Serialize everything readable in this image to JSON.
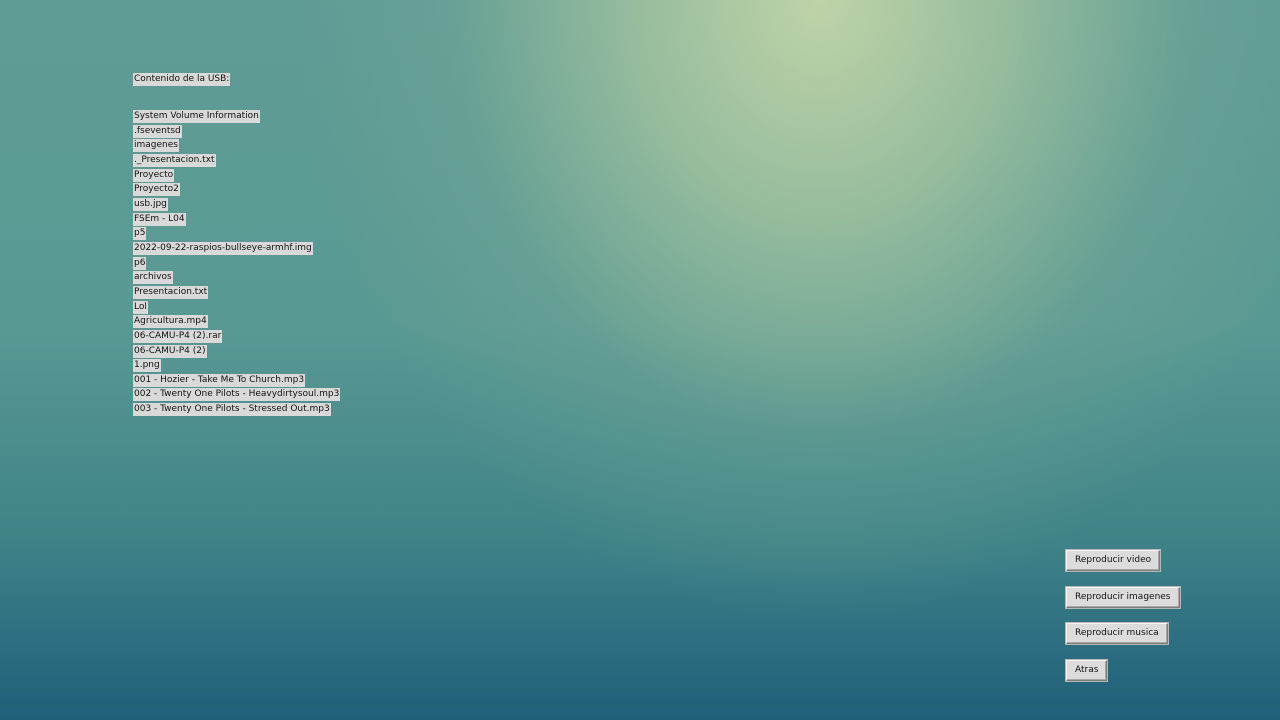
{
  "heading": "Contenido de la USB:",
  "files": [
    "System Volume Information",
    ".fseventsd",
    "imagenes",
    "._Presentacion.txt",
    "Proyecto",
    "Proyecto2",
    "usb.jpg",
    "FSEm - L04",
    "p5",
    "2022-09-22-raspios-bullseye-armhf.img",
    "p6",
    "archivos",
    "Presentacion.txt",
    "Lol",
    "Agricultura.mp4",
    "06-CAMU-P4 (2).rar",
    "06-CAMU-P4 (2)",
    "1.png",
    "001 - Hozier - Take Me To Church.mp3",
    "002 - Twenty One Pilots - Heavydirtysoul.mp3",
    "003 - Twenty One Pilots - Stressed Out.mp3"
  ],
  "buttons": {
    "video": "Reproducir video",
    "imagenes": "Reproducir imagenes",
    "musica": "Reproducir musica",
    "atras": "Atras"
  },
  "colors": {
    "label_bg": "#d9d9d9",
    "button_bg": "#dcdcdc"
  }
}
